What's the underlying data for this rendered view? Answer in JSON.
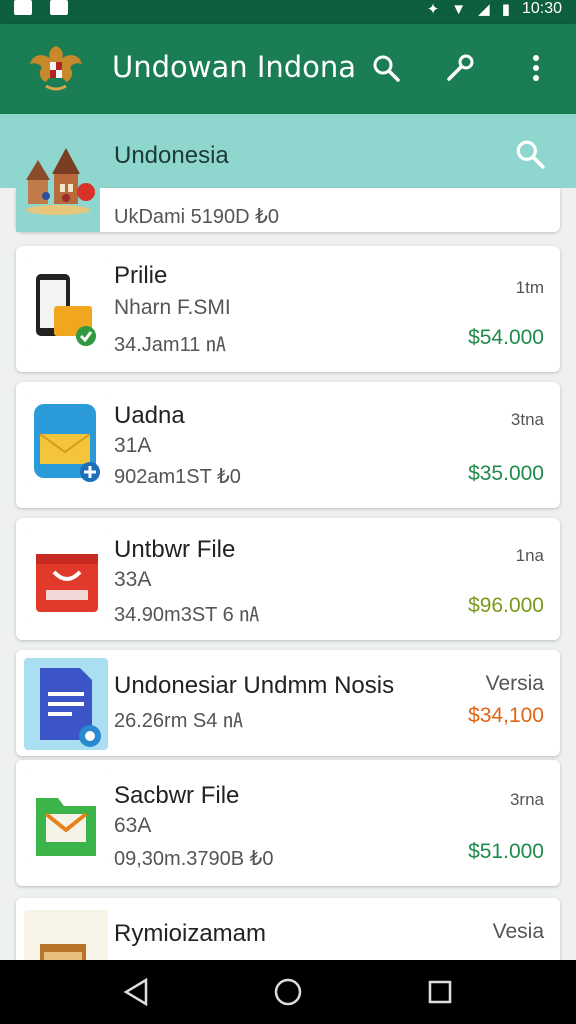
{
  "status": {
    "time": "10:30"
  },
  "appbar": {
    "title": "Undowan Indona"
  },
  "region": {
    "title": "Undonesia",
    "meta": "UkDami 5190D ₺0"
  },
  "items": [
    {
      "name": "Prilie",
      "sub": "Nharn F.SMI",
      "meta": "34.Jam11 ㎁",
      "tag": "1tm",
      "price": "$54.000",
      "price_color": "#1f8a4a"
    },
    {
      "name": "Uadna",
      "sub": "31A",
      "meta": "902am1ST ₺0",
      "tag": "3tna",
      "price": "$35.000",
      "price_color": "#1f8a4a"
    },
    {
      "name": "Untbwr File",
      "sub": "33A",
      "meta": "34.90m3ST 6 ㎁",
      "tag": "1na",
      "price": "$96.000",
      "price_color": "#7a9a1a"
    },
    {
      "name": "Undonesiar Undmm Nosis",
      "sub": "",
      "meta": "26.26rm S4 ㎁",
      "tag": "Versia",
      "price": "$34,100",
      "price_color": "#e06414"
    },
    {
      "name": "Sacbwr File",
      "sub": "63A",
      "meta": "09,30m.3790B ₺0",
      "tag": "3rna",
      "price": "$51.000",
      "price_color": "#1f8a4a"
    },
    {
      "name": "Rymioizamam",
      "sub": "",
      "meta": "",
      "tag": "Vesia",
      "price": "",
      "price_color": "#1f8a4a"
    }
  ]
}
